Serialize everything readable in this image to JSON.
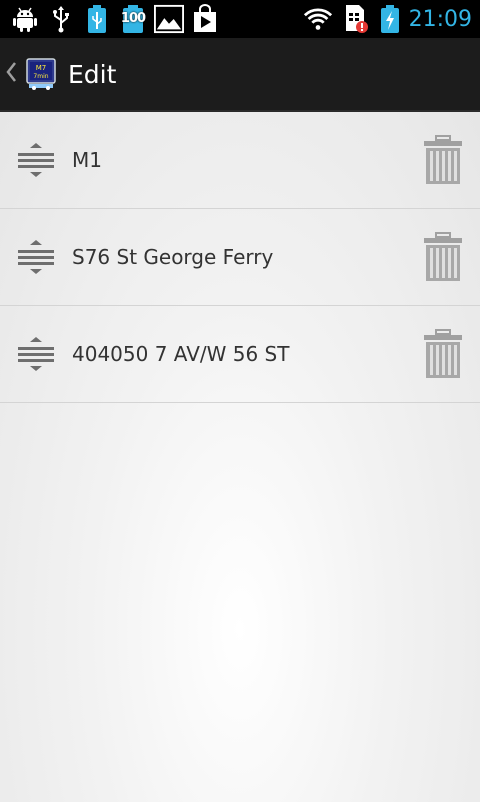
{
  "status_bar": {
    "time": "21:09",
    "notification_icons": [
      "android-debug-icon",
      "usb-icon",
      "battery-usb-icon",
      "battery-100-icon",
      "gallery-icon",
      "play-store-icon"
    ],
    "battery_badge": "100",
    "system_icons": [
      "wifi-icon",
      "sim-alert-icon",
      "battery-charging-icon"
    ]
  },
  "action_bar": {
    "title": "Edit",
    "app_icon_text_top": "M7",
    "app_icon_text_bottom": "7min"
  },
  "list": {
    "items": [
      {
        "label": "M1"
      },
      {
        "label": "S76 St George Ferry"
      },
      {
        "label": "404050 7 AV/W 56 ST"
      }
    ]
  },
  "colors": {
    "accent": "#33b5e5",
    "action_bar_bg": "#1c1c1c",
    "list_text": "#333333",
    "icon_gray": "#8a8a8a"
  }
}
